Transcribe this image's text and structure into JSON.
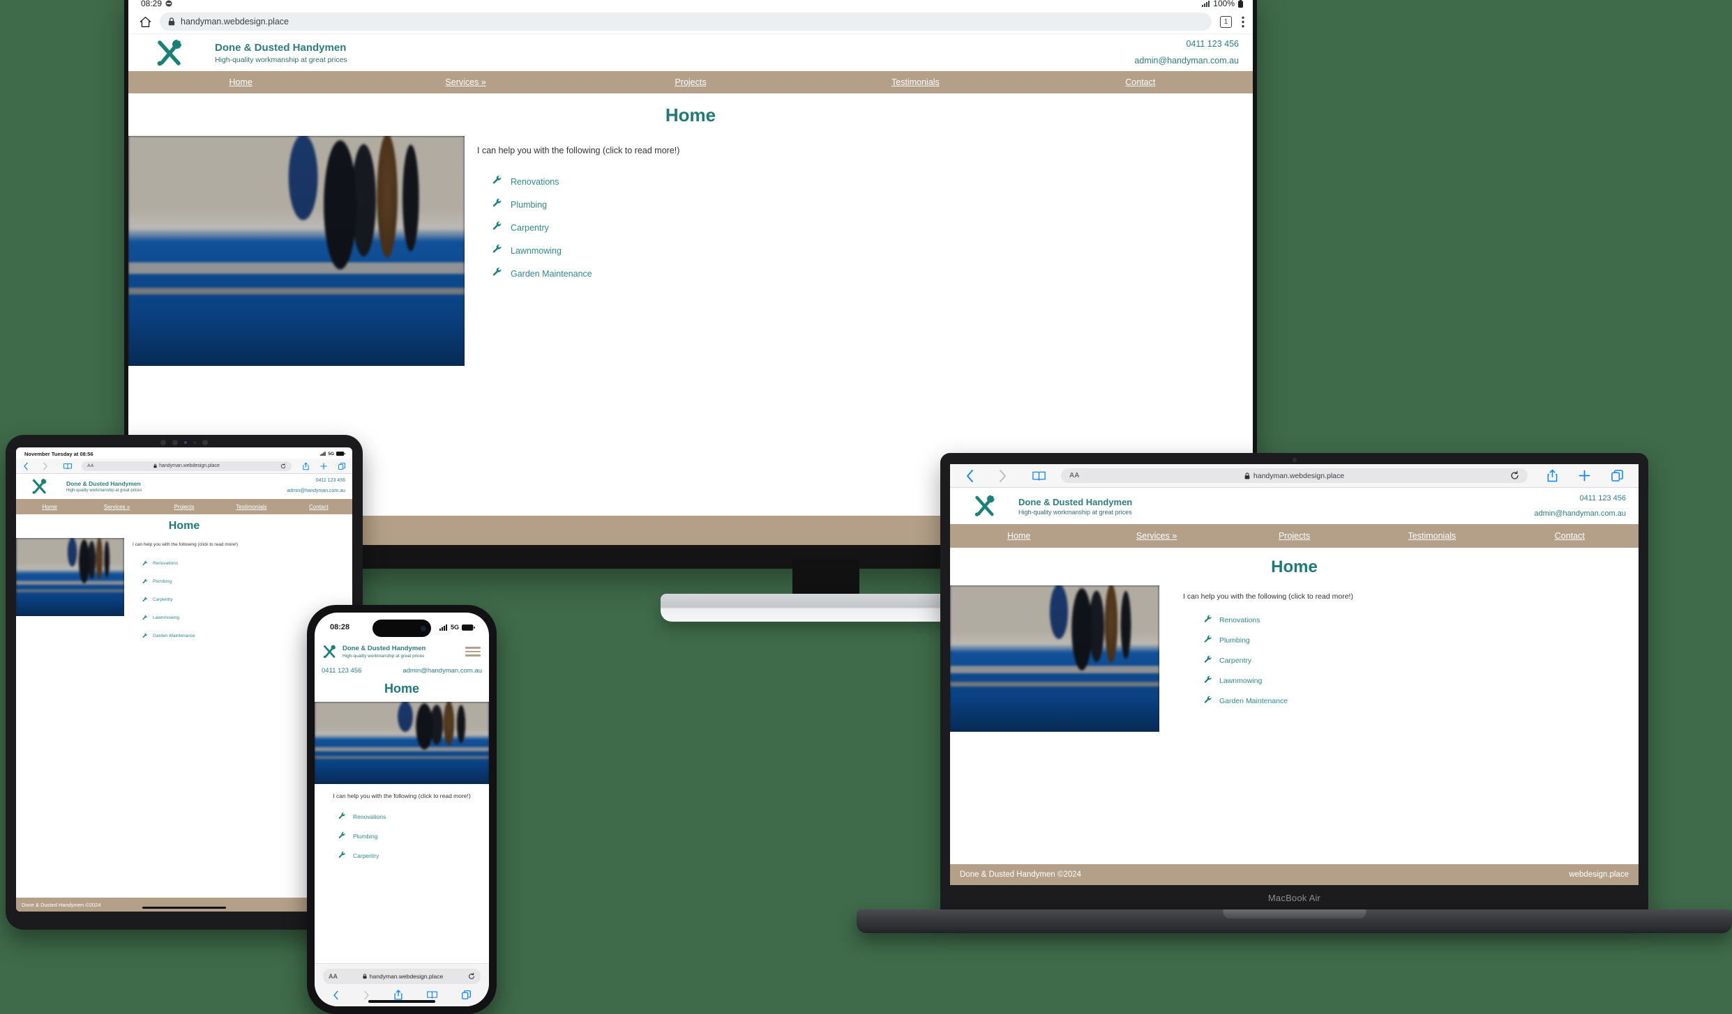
{
  "background_color": "#3f6b4a",
  "site": {
    "brand_name": "Done & Dusted Handymen",
    "tagline": "High-quality workmanship at great prices",
    "phone": "0411 123 456",
    "email": "admin@handyman.com.au",
    "nav": [
      "Home",
      "Services »",
      "Projects",
      "Testimonials",
      "Contact"
    ],
    "page_title": "Home",
    "intro": "I can help you with the following (click to read more!)",
    "services": [
      "Renovations",
      "Plumbing",
      "Carpentry",
      "Lawnmowing",
      "Garden Maintenance"
    ],
    "footer_left": "Done & Dusted Handymen ©2024",
    "footer_right": "webdesign.place",
    "colors": {
      "nav_bar": "#b4a088",
      "brand_teal": "#2c7d7d",
      "link_teal": "#2e8b8b",
      "title_teal": "#1e7a7a"
    }
  },
  "monitor": {
    "device_label": "Desktop monitor",
    "status_time": "08:29",
    "status_battery": "100%",
    "url": "handyman.webdesign.place",
    "tab_count": "1",
    "icons": [
      "home-icon",
      "lock-icon",
      "tab-count-icon",
      "overflow-menu-icon",
      "signal-icon",
      "battery-icon"
    ]
  },
  "laptop": {
    "device_label": "MacBook Air",
    "url": "handyman.webdesign.place",
    "text_size_label": "AA",
    "icons": [
      "back-chevron-icon",
      "forward-chevron-icon",
      "bookmarks-icon",
      "lock-icon",
      "reload-icon",
      "share-icon",
      "new-tab-icon",
      "tabs-icon"
    ]
  },
  "tablet": {
    "device_label": "Tablet",
    "status_text": "November Tuesday at 08:56",
    "status_network": "5G",
    "url": "handyman.webdesign.place",
    "text_size_label": "AA",
    "icons": [
      "back-chevron-icon",
      "forward-chevron-icon",
      "bookmarks-icon",
      "lock-icon",
      "reload-icon",
      "share-icon",
      "new-tab-icon",
      "tabs-icon",
      "signal-icon",
      "battery-icon"
    ]
  },
  "phone": {
    "device_label": "iPhone",
    "status_time": "08:28",
    "status_network": "5G",
    "url": "handyman.webdesign.place",
    "text_size_label": "AA",
    "services_visible": [
      "Renovations",
      "Plumbing",
      "Carpentry"
    ],
    "icons": [
      "hamburger-menu-icon",
      "lock-icon",
      "reload-icon",
      "back-chevron-icon",
      "forward-chevron-icon",
      "share-icon",
      "bookmarks-icon",
      "tabs-icon",
      "signal-icon",
      "battery-icon"
    ]
  }
}
